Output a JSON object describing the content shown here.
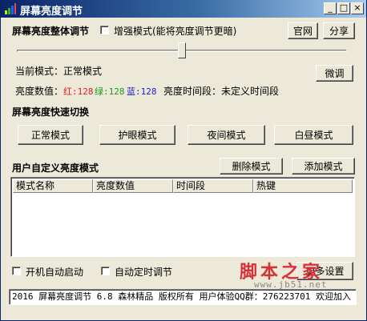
{
  "window": {
    "title": "屏幕亮度调节",
    "minimize_glyph": "_",
    "maximize_glyph": "□",
    "close_glyph": "×"
  },
  "top": {
    "section_title": "屏幕亮度整体调节",
    "enhance_label": "增强模式(能将亮度调节更暗)",
    "enhance_checked": false,
    "official_site_label": "官网",
    "share_label": "分享"
  },
  "slider": {
    "level_percent": 50
  },
  "status": {
    "mode_label": "当前模式：正常模式",
    "fine_tune_label": "微调",
    "brightness_prefix": "亮度数值：",
    "red_label": "红:128",
    "green_label": "绿:128",
    "blue_label": "蓝:128",
    "period_label": "亮度时间段：未定义时间段"
  },
  "quick": {
    "section_title": "屏幕亮度快速切换",
    "buttons": [
      "正常模式",
      "护眼模式",
      "夜间模式",
      "白昼模式"
    ]
  },
  "custom": {
    "section_title": "用户自定义亮度模式",
    "delete_label": "删除模式",
    "add_label": "添加模式",
    "columns": [
      "模式名称",
      "亮度数值",
      "时间段",
      "热键"
    ],
    "rows": []
  },
  "options": {
    "autostart_label": "开机自动启动",
    "autostart_checked": false,
    "auto_timer_label": "自动定时调节",
    "auto_timer_checked": false,
    "more_settings_label": "更多设置"
  },
  "statusbar": {
    "text": "2016 屏幕亮度调节 6.8 森林精品 版权所有 用户体验QQ群：276223701 欢迎加入"
  },
  "watermark": {
    "text": "脚本之家",
    "url": "www.jb51.net"
  },
  "colors": {
    "red": "#e02020",
    "green": "#1a9a1a",
    "blue": "#2020d0",
    "watermark": "#d6313a"
  }
}
